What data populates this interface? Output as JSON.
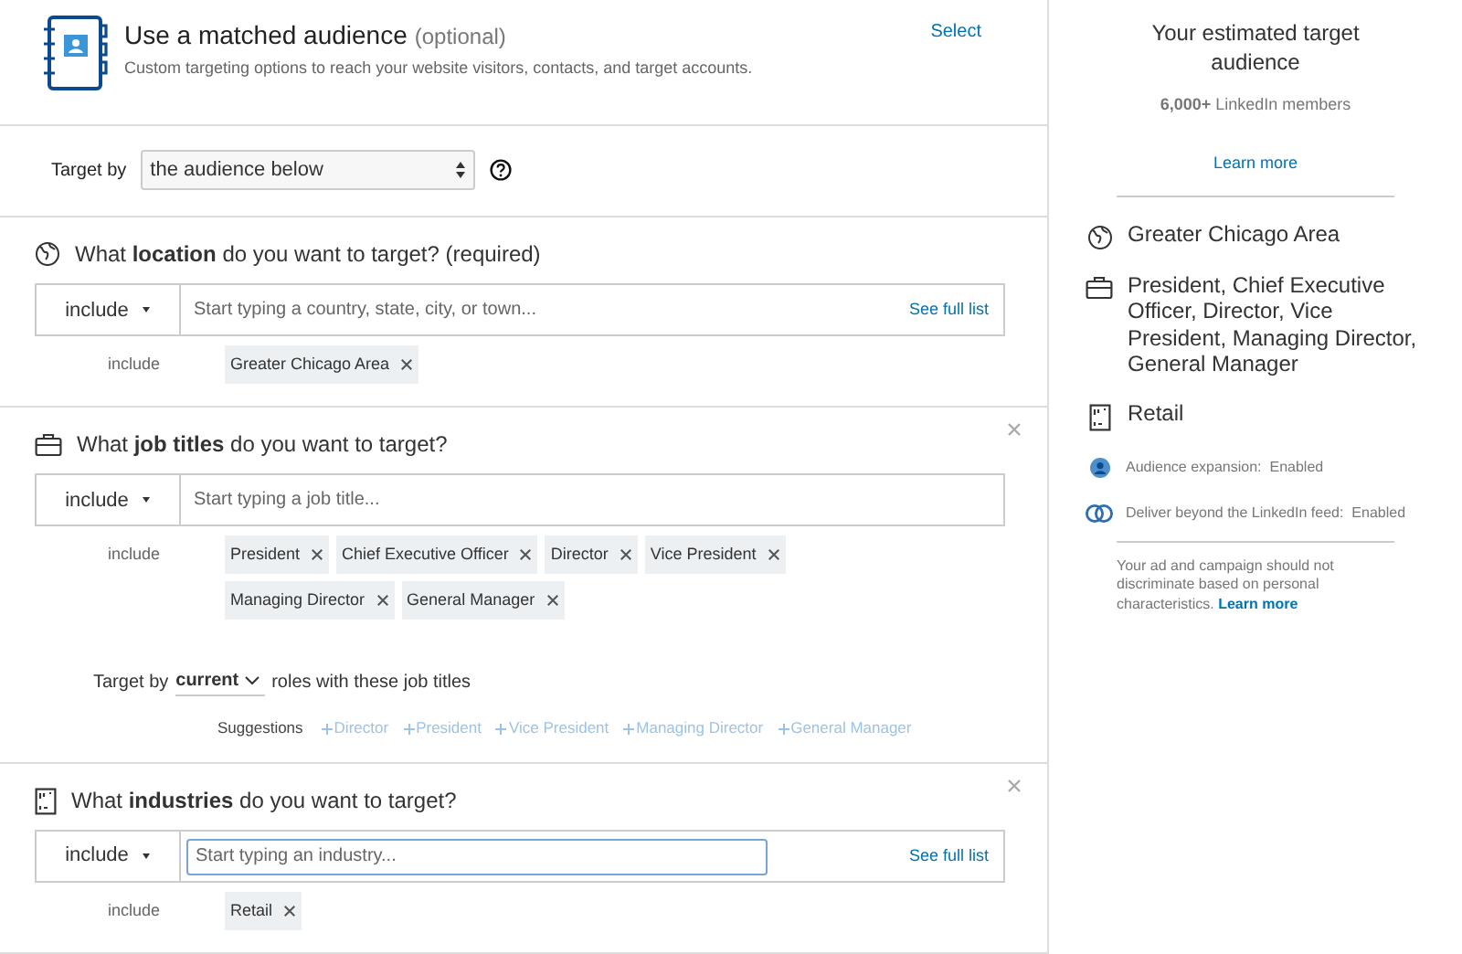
{
  "header": {
    "title": "Use a matched audience",
    "optional": "(optional)",
    "subtitle": "Custom targeting options to reach your website visitors, contacts, and target accounts.",
    "action": "Select"
  },
  "target_by": {
    "label": "Target by",
    "value": "the audience below"
  },
  "sections": [
    {
      "kind": "location",
      "question": "What **location** do you want to target? (required)",
      "mode": "include",
      "placeholder": "Start typing a country, state, city, or town...",
      "see_full_list": "See full list",
      "closable": false,
      "focused": false,
      "include_label": "include",
      "tags": [
        "Greater Chicago Area"
      ]
    },
    {
      "kind": "job",
      "question": "What **job titles** do you want to target?",
      "mode": "include",
      "placeholder": "Start typing a job title...",
      "closable": true,
      "focused": false,
      "include_label": "include",
      "tags": [
        "President",
        "Chief Executive Officer",
        "Director",
        "Vice President",
        "Managing Director",
        "General Manager"
      ],
      "role_filter": {
        "prefix": "Target by",
        "value": "current",
        "suffix": "roles with these job titles"
      },
      "suggestions": {
        "label": "Suggestions",
        "items": [
          "Director",
          "President",
          "Vice President",
          "Managing Director",
          "General Manager"
        ]
      }
    },
    {
      "kind": "industry",
      "question": "What **industries** do you want to target?",
      "mode": "include",
      "placeholder": "Start typing an industry...",
      "see_full_list": "See full list",
      "closable": true,
      "focused": true,
      "include_label": "include",
      "tags": [
        "Retail"
      ]
    }
  ],
  "summary": {
    "title": "Your estimated target audience",
    "count": "**6,000+** LinkedIn members",
    "learn_more": "Learn more",
    "items": [
      {
        "kind": "location",
        "text": "Greater Chicago Area"
      },
      {
        "kind": "job",
        "text": "President, Chief Executive Officer, Director, Vice President, Managing Director, General Manager"
      },
      {
        "kind": "industry",
        "text": "Retail"
      }
    ],
    "settings": [
      {
        "kind": "expansion",
        "label": "Audience expansion:",
        "value": "Enabled"
      },
      {
        "kind": "network",
        "label": "Deliver beyond the LinkedIn feed:",
        "value": "Enabled"
      }
    ],
    "disclaimer": "Your ad and campaign should not discriminate based on personal characteristics.",
    "disclaimer_link": "Learn more"
  }
}
